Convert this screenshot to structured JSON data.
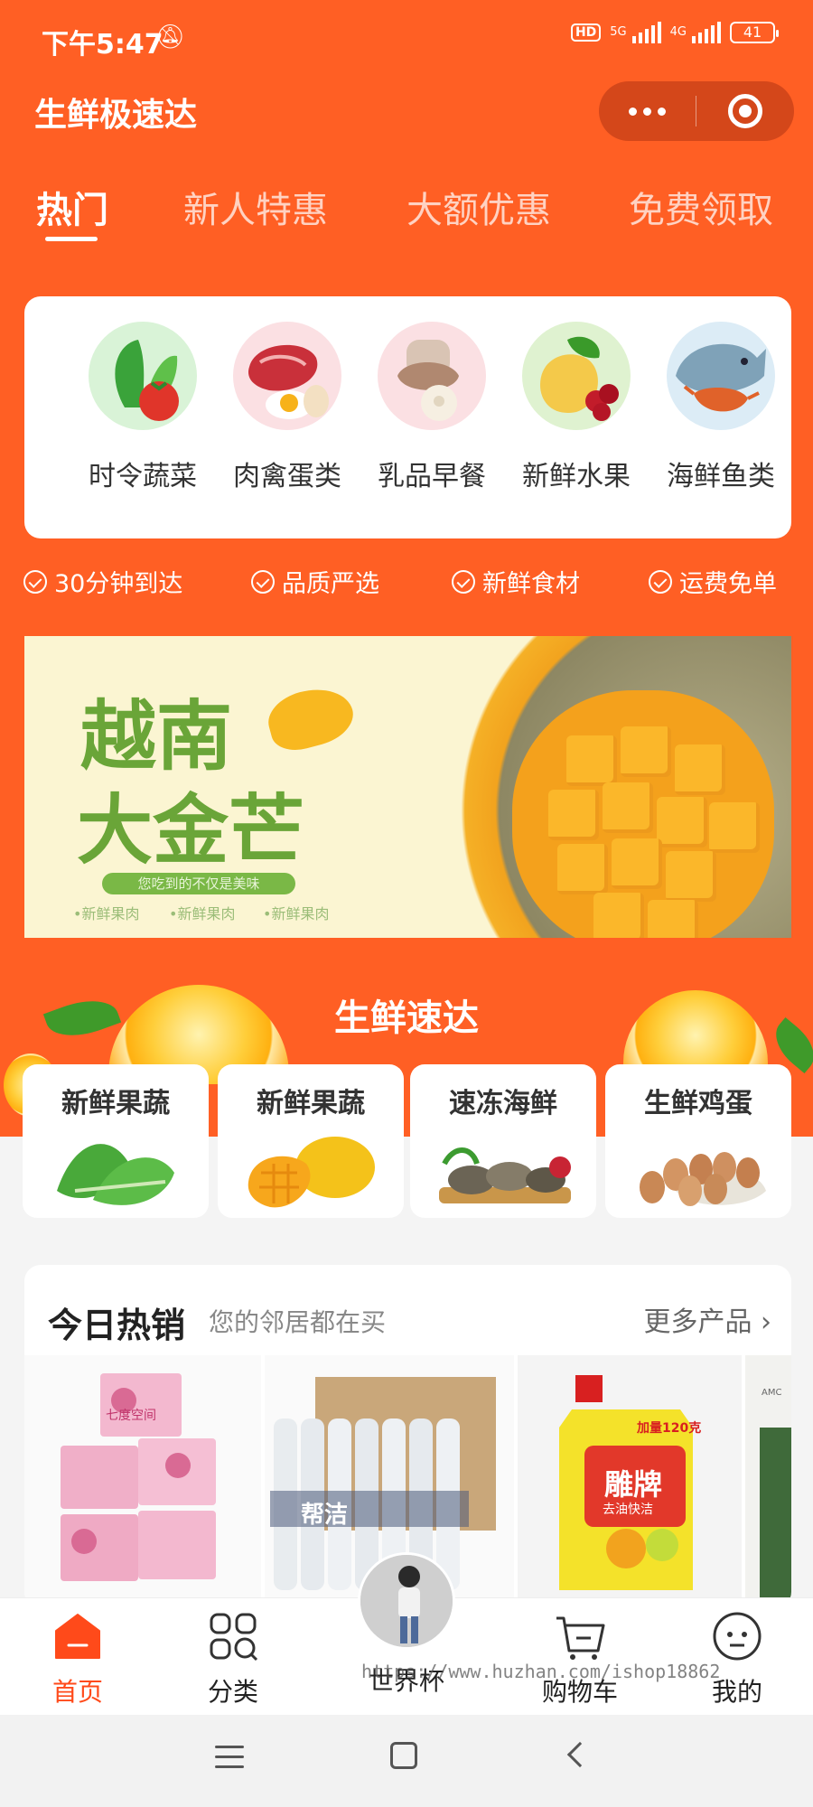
{
  "status_bar": {
    "time": "下午5:47",
    "hd": "HD",
    "net1": "5G",
    "net2": "4G",
    "battery": "41"
  },
  "header": {
    "title": "生鲜极速达"
  },
  "tabs": [
    {
      "label": "热门",
      "active": true
    },
    {
      "label": "新人特惠",
      "active": false
    },
    {
      "label": "大额优惠",
      "active": false
    },
    {
      "label": "免费领取",
      "active": false
    }
  ],
  "categories": [
    {
      "label": "时令蔬菜",
      "icon": "vegetable-icon"
    },
    {
      "label": "肉禽蛋类",
      "icon": "meat-egg-icon"
    },
    {
      "label": "乳品早餐",
      "icon": "breakfast-icon"
    },
    {
      "label": "新鲜水果",
      "icon": "fruit-icon"
    },
    {
      "label": "海鲜鱼类",
      "icon": "seafood-icon"
    }
  ],
  "features": [
    "30分钟到达",
    "品质严选",
    "新鲜食材",
    "运费免单"
  ],
  "banner": {
    "title_line1": "越南",
    "title_line2": "大金芒",
    "slogan": "您吃到的不仅是美味",
    "tags": [
      "•新鲜果肉",
      "•新鲜果肉",
      "•新鲜果肉"
    ]
  },
  "express": {
    "title": "生鲜速达",
    "items": [
      {
        "label": "新鲜果蔬",
        "icon": "greens-icon"
      },
      {
        "label": "新鲜果蔬",
        "icon": "mango-icon"
      },
      {
        "label": "速冻海鲜",
        "icon": "clams-icon"
      },
      {
        "label": "生鲜鸡蛋",
        "icon": "eggs-icon"
      }
    ]
  },
  "hot_sales": {
    "title": "今日热销",
    "subtitle": "您的邻居都在买",
    "more": "更多产品",
    "products": [
      {
        "name": "七度空间",
        "icon": "sanitary-pads-product"
      },
      {
        "name": "帮洁",
        "icon": "cleaner-bottles-product"
      },
      {
        "name": "雕牌",
        "icon": "dish-soap-product",
        "badge": "加量120克",
        "tag": "去油快洁"
      },
      {
        "name": "AMC",
        "icon": "partial-product"
      }
    ]
  },
  "bottom_nav": [
    {
      "label": "首页",
      "icon": "home-icon",
      "active": true
    },
    {
      "label": "分类",
      "icon": "category-icon",
      "active": false
    },
    {
      "label": "世界杯",
      "icon": "worldcup-avatar-icon",
      "active": false
    },
    {
      "label": "购物车",
      "icon": "cart-icon",
      "active": false
    },
    {
      "label": "我的",
      "icon": "profile-icon",
      "active": false
    }
  ],
  "watermark": "https://www.huzhan.com/ishop18862",
  "colors": {
    "brand": "#ff5f24",
    "active_nav": "#ff4a1a",
    "banner_green": "#6aa538"
  }
}
